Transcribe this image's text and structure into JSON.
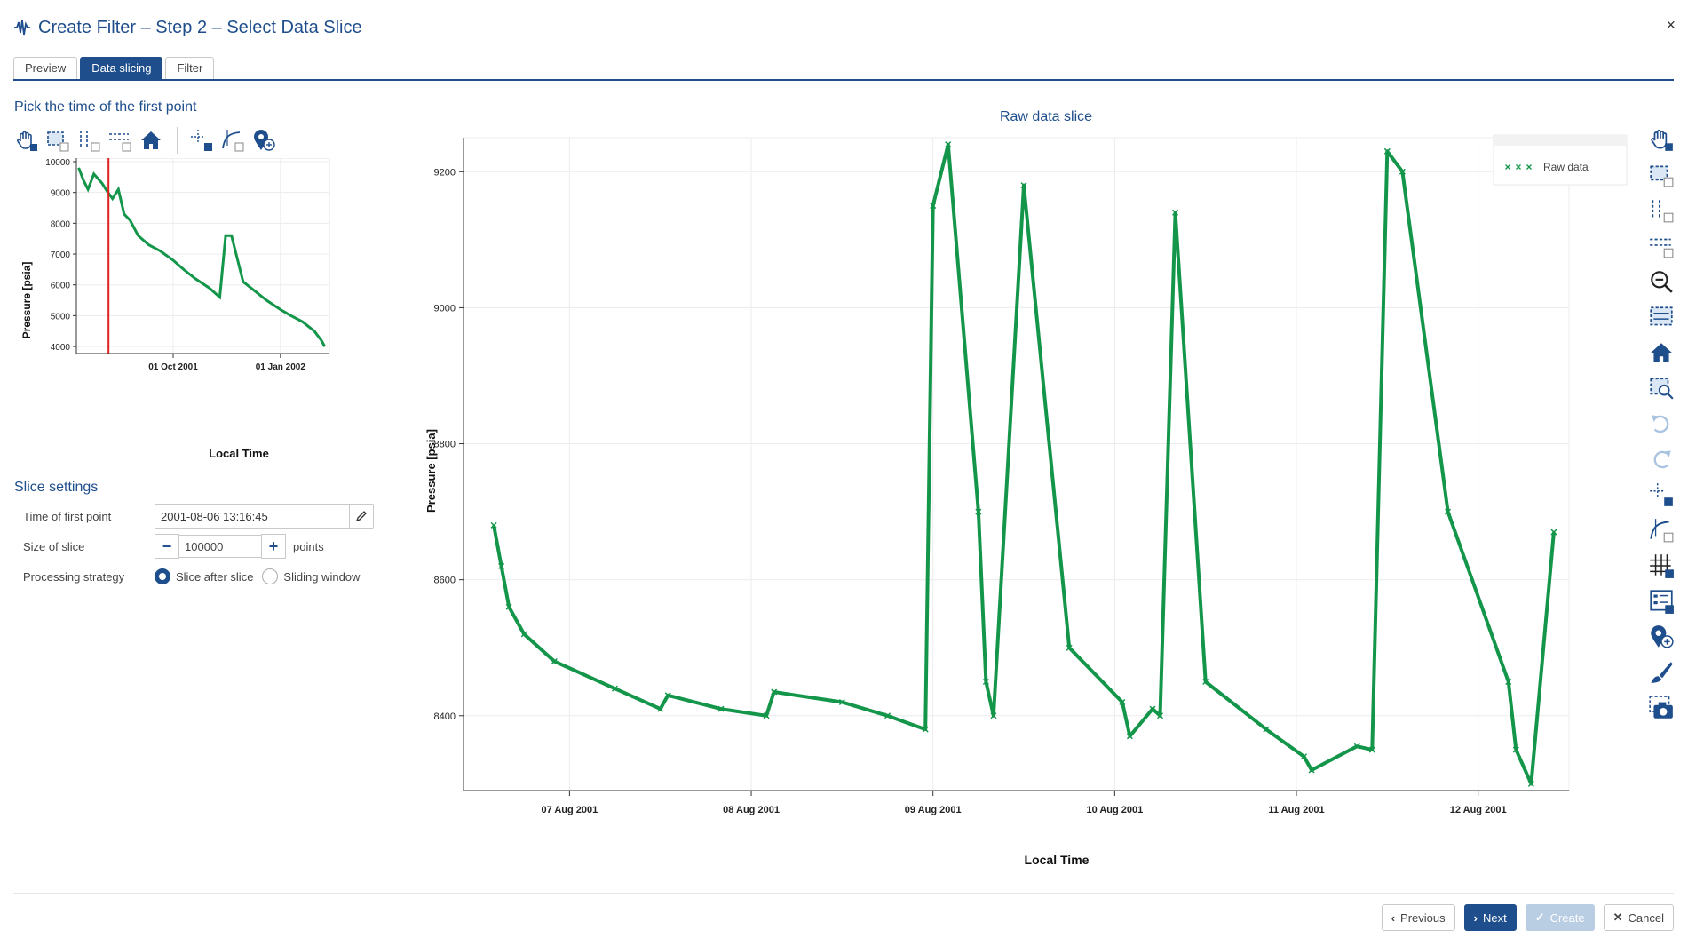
{
  "dialog": {
    "title": "Create Filter – Step 2 – Select Data Slice",
    "close_label": "×"
  },
  "tabs": [
    {
      "label": "Preview",
      "active": false
    },
    {
      "label": "Data slicing",
      "active": true
    },
    {
      "label": "Filter",
      "active": false
    }
  ],
  "pick_section": {
    "title": "Pick the time of the first point"
  },
  "left_toolbar": [
    "pan-icon",
    "box-zoom-icon",
    "x-zoom-icon",
    "y-zoom-icon",
    "home-icon",
    "crosshair-icon",
    "curve-tool-icon",
    "hover-pin-icon"
  ],
  "chart_data": [
    {
      "type": "line",
      "xlabel": "Local Time",
      "ylabel": "Pressure [psia]",
      "ylim": [
        3800,
        10000
      ],
      "yticks": [
        "10000",
        "9000",
        "8000",
        "7000",
        "6000",
        "5000",
        "4000"
      ],
      "xticks": [
        "01 Oct 2001",
        "01 Jan 2002"
      ],
      "marker_time": "2001-08-06 13:16:45",
      "series": [
        {
          "x": [
            "2001-07-12",
            "2001-07-16",
            "2001-07-20",
            "2001-07-25",
            "2001-08-01",
            "2001-08-06",
            "2001-08-10",
            "2001-08-15",
            "2001-08-20",
            "2001-08-25",
            "2001-09-01",
            "2001-09-10",
            "2001-09-20",
            "2001-10-01",
            "2001-10-10",
            "2001-10-20",
            "2001-11-01",
            "2001-11-10",
            "2001-11-15",
            "2001-11-20",
            "2001-11-30",
            "2001-12-10",
            "2001-12-20",
            "2002-01-01",
            "2002-01-10",
            "2002-01-20",
            "2002-01-30",
            "2002-02-05",
            "2002-02-08"
          ],
          "values": [
            9800,
            9400,
            9100,
            9600,
            9300,
            9000,
            8800,
            9100,
            8300,
            8100,
            7600,
            7300,
            7100,
            6800,
            6500,
            6200,
            5900,
            5600,
            7600,
            7600,
            6100,
            5800,
            5500,
            5200,
            5000,
            4800,
            4500,
            4200,
            4000
          ]
        }
      ]
    },
    {
      "type": "scatter",
      "title": "Raw data slice",
      "xlabel": "Local Time",
      "ylabel": "Pressure [psia]",
      "ylim": [
        8290,
        9250
      ],
      "yticks": [
        "9200",
        "9000",
        "8800",
        "8600",
        "8400"
      ],
      "xticks": [
        "07 Aug 2001",
        "08 Aug 2001",
        "09 Aug 2001",
        "10 Aug 2001",
        "11 Aug 2001",
        "12 Aug 2001"
      ],
      "legend_position": "top-right",
      "series": [
        {
          "name": "Raw data",
          "x": [
            "2001-08-06 14:00",
            "2001-08-06 15:00",
            "2001-08-06 16:00",
            "2001-08-06 18:00",
            "2001-08-06 22:00",
            "2001-08-07 06:00",
            "2001-08-07 12:00",
            "2001-08-07 13:00",
            "2001-08-07 20:00",
            "2001-08-08 02:00",
            "2001-08-08 03:00",
            "2001-08-08 12:00",
            "2001-08-08 18:00",
            "2001-08-08 23:00",
            "2001-08-09 00:00",
            "2001-08-09 02:00",
            "2001-08-09 06:00",
            "2001-08-09 07:00",
            "2001-08-09 08:00",
            "2001-08-09 12:00",
            "2001-08-09 18:00",
            "2001-08-10 01:00",
            "2001-08-10 02:00",
            "2001-08-10 05:00",
            "2001-08-10 06:00",
            "2001-08-10 08:00",
            "2001-08-10 12:00",
            "2001-08-10 20:00",
            "2001-08-11 01:00",
            "2001-08-11 02:00",
            "2001-08-11 08:00",
            "2001-08-11 10:00",
            "2001-08-11 12:00",
            "2001-08-11 14:00",
            "2001-08-11 20:00",
            "2001-08-12 04:00",
            "2001-08-12 05:00",
            "2001-08-12 07:00",
            "2001-08-12 10:00"
          ],
          "values": [
            8680,
            8620,
            8560,
            8520,
            8480,
            8440,
            8410,
            8430,
            8410,
            8400,
            8435,
            8420,
            8400,
            8380,
            9150,
            9240,
            8700,
            8450,
            8400,
            9180,
            8500,
            8420,
            8370,
            8410,
            8400,
            9140,
            8450,
            8380,
            8340,
            8320,
            8355,
            8350,
            9230,
            9200,
            8700,
            8450,
            8350,
            8300,
            8670
          ]
        }
      ]
    }
  ],
  "slice_settings": {
    "title": "Slice settings",
    "time_label": "Time of first point",
    "time_value": "2001-08-06 13:16:45",
    "size_label": "Size of slice",
    "size_value": "100000",
    "size_unit": "points",
    "minus": "−",
    "plus": "+",
    "strategy_label": "Processing strategy",
    "option_slice": "Slice after slice",
    "option_window": "Sliding window",
    "selected": "Slice after slice"
  },
  "right_toolbar": [
    "pan-icon",
    "box-zoom-icon",
    "x-zoom-icon",
    "y-zoom-icon",
    "zoom-out-icon",
    "reset-zoom-icon",
    "home-icon",
    "zoom-to-fit-icon",
    "undo-icon",
    "redo-icon",
    "crosshair-icon",
    "curve-tool-icon",
    "grid-icon",
    "legend-icon",
    "hover-pin-icon",
    "brush-icon",
    "camera-icon"
  ],
  "footer": {
    "previous": "Previous",
    "next": "Next",
    "create": "Create",
    "cancel": "Cancel"
  },
  "colors": {
    "accent": "#1f4e8c",
    "data_green": "#14964a",
    "marker_red": "#e02020"
  }
}
